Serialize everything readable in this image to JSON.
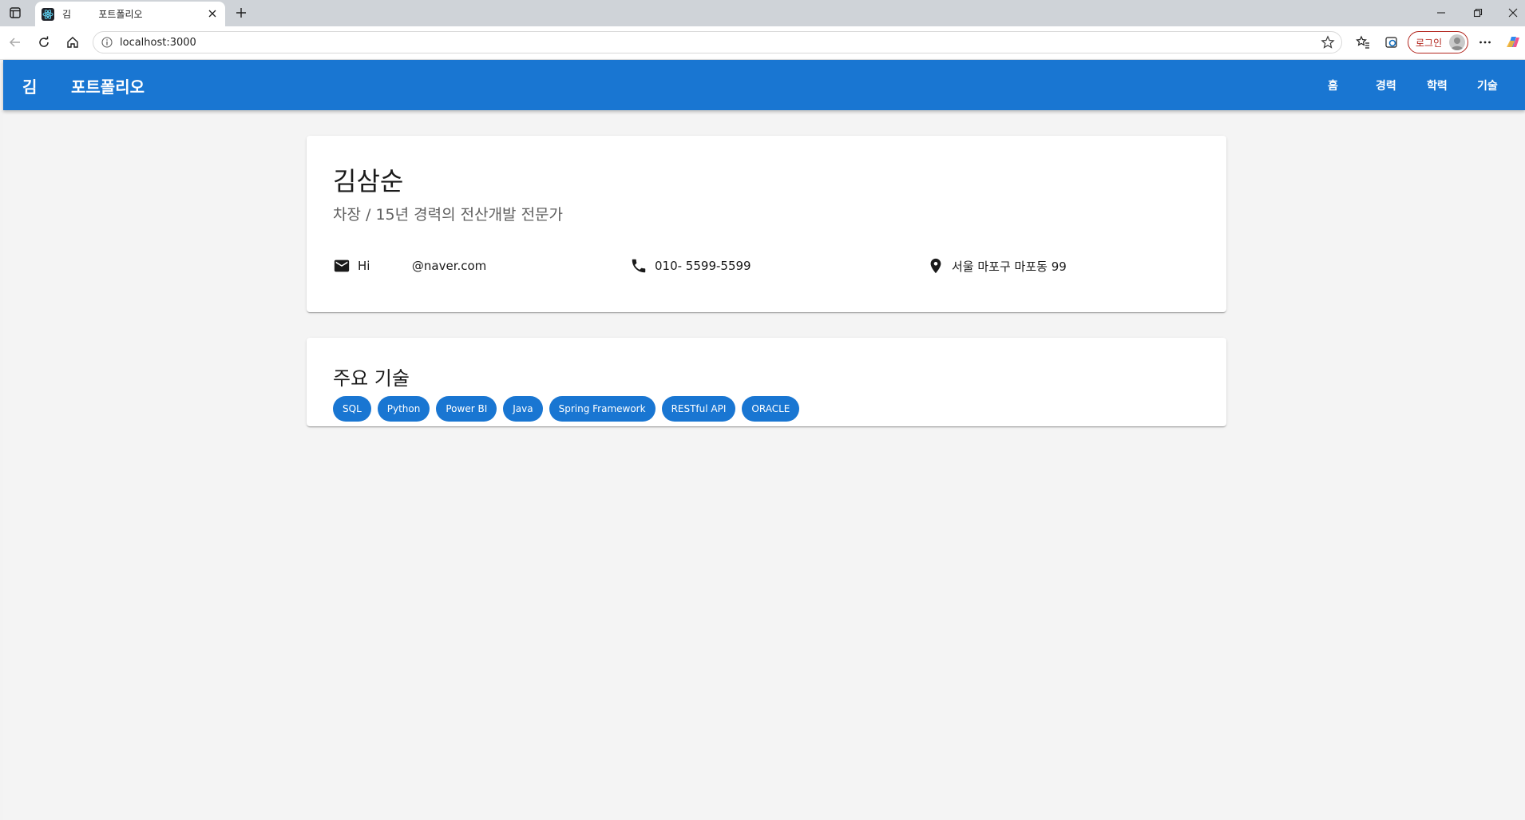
{
  "browser": {
    "tab": {
      "title": "김         포트폴리오",
      "favicon": "react-icon"
    },
    "address": {
      "url": "localhost:3000"
    },
    "profile_label": "로그인"
  },
  "appbar": {
    "initial": "김",
    "title": "포트폴리오",
    "nav": [
      "홈",
      "경력",
      "학력",
      "기술"
    ],
    "color": "#1976d2"
  },
  "profile": {
    "name": "김삼순",
    "subtitle": "차장 / 15년 경력의 전산개발 전문가",
    "email": "Hi           @naver.com",
    "phone": "010- 5599-5599",
    "address": "서울 마포구 마포동 99"
  },
  "skills": {
    "title": "주요 기술",
    "items": [
      "SQL",
      "Python",
      "Power BI",
      "Java",
      "Spring Framework",
      "RESTful API",
      "ORACLE"
    ]
  }
}
